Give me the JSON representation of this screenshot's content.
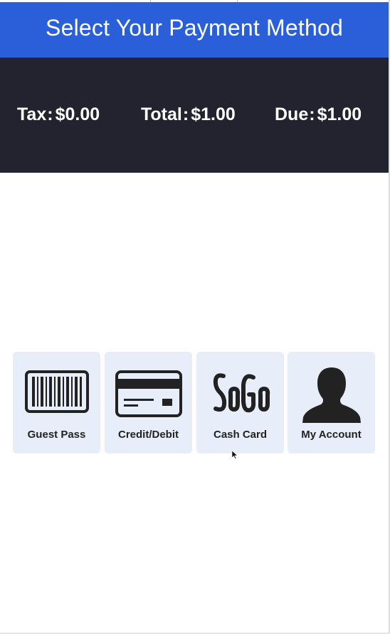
{
  "header": {
    "title": "Select Your Payment Method"
  },
  "summary": {
    "tax_label": "Tax",
    "tax_value": "$0.00",
    "total_label": "Total",
    "total_value": "$1.00",
    "due_label": "Due",
    "due_value": "$1.00"
  },
  "payment_methods": [
    {
      "label": "Guest Pass",
      "icon": "barcode-icon"
    },
    {
      "label": "Credit/Debit",
      "icon": "credit-card-icon"
    },
    {
      "label": "Cash Card",
      "icon": "sogo-logo"
    },
    {
      "label": "My Account",
      "icon": "user-silhouette-icon"
    }
  ],
  "colors": {
    "header_bg": "#2b5fd9",
    "summary_bg": "#23232f",
    "tile_bg": "#e8edfa",
    "icon_color": "#222222"
  }
}
